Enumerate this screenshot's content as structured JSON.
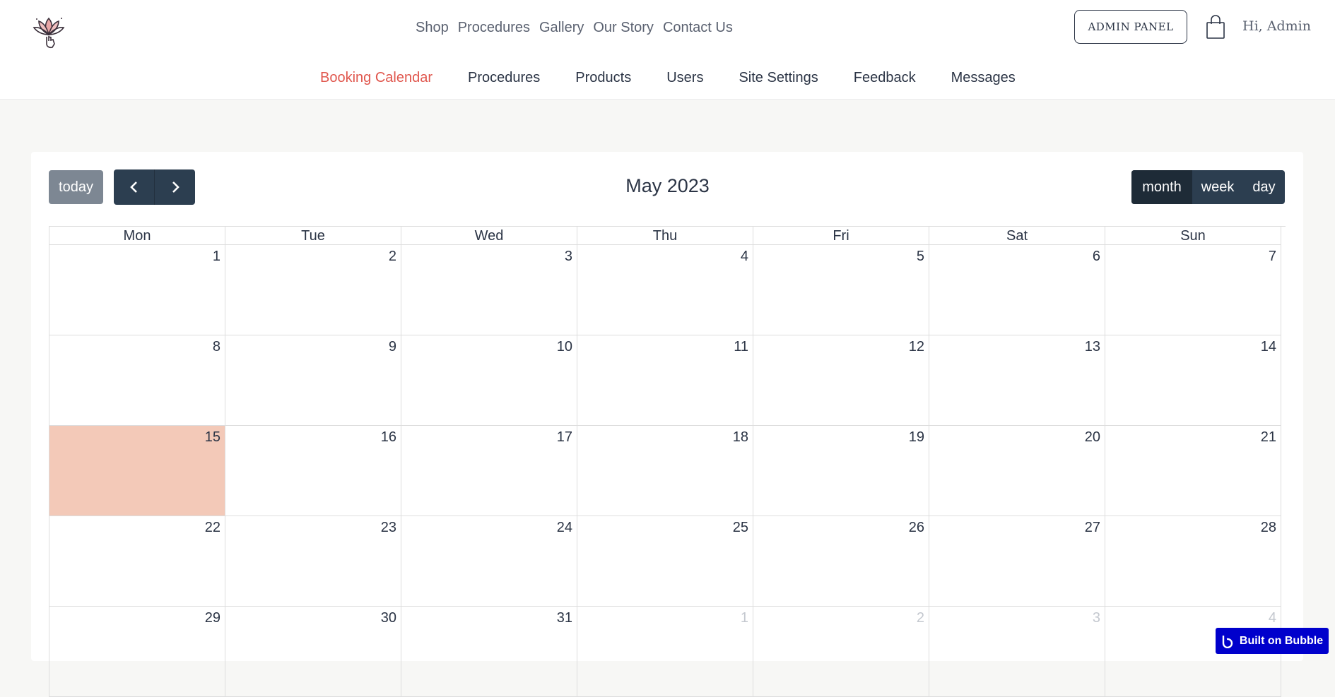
{
  "header": {
    "nav": [
      "Shop",
      "Procedures",
      "Gallery",
      "Our Story",
      "Contact Us"
    ],
    "admin_button": "ADMIN PANEL",
    "greeting": "Hi, Admin"
  },
  "subnav": {
    "items": [
      "Booking Calendar",
      "Procedures",
      "Products",
      "Users",
      "Site Settings",
      "Feedback",
      "Messages"
    ],
    "active": "Booking Calendar"
  },
  "calendar": {
    "today_label": "today",
    "title": "May 2023",
    "views": [
      "month",
      "week",
      "day"
    ],
    "active_view": "month",
    "weekdays": [
      "Mon",
      "Tue",
      "Wed",
      "Thu",
      "Fri",
      "Sat",
      "Sun"
    ],
    "weeks": [
      [
        1,
        2,
        3,
        4,
        5,
        6,
        7
      ],
      [
        8,
        9,
        10,
        11,
        12,
        13,
        14
      ],
      [
        15,
        16,
        17,
        18,
        19,
        20,
        21
      ],
      [
        22,
        23,
        24,
        25,
        26,
        27,
        28
      ],
      [
        29,
        30,
        31,
        1,
        2,
        3,
        4
      ]
    ],
    "today_date": 15,
    "other_month_from_index_in_last_week": 3,
    "today_highlight_color": "#f3c9b8"
  },
  "colors": {
    "active_nav": "#e0574e",
    "dark_button": "#2c3e50",
    "today_button": "#7d8793",
    "bubble_badge": "#0000cc"
  },
  "badge": {
    "label": "Built on Bubble"
  }
}
